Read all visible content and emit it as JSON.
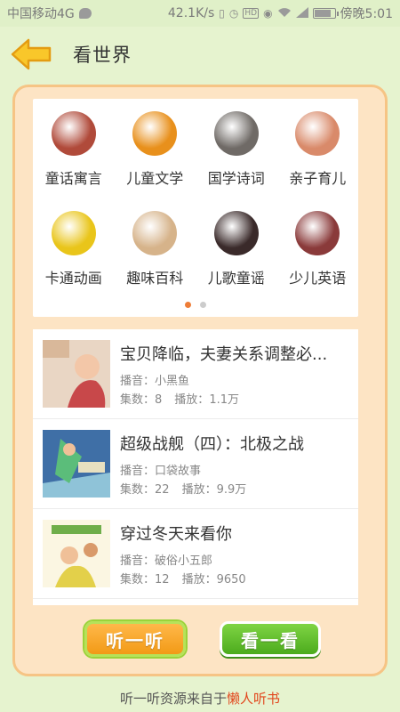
{
  "status_bar": {
    "carrier": "中国移动4G",
    "speed": "42.1K/s",
    "hd": "HD",
    "time": "傍晚5:01",
    "battery_level": 0.85
  },
  "header": {
    "back_icon": "back-arrow-icon",
    "title": "看世界"
  },
  "categories": [
    {
      "label": "童话寓言",
      "color": "#b04a3a"
    },
    {
      "label": "儿童文学",
      "color": "#e8901c"
    },
    {
      "label": "国学诗词",
      "color": "#6f6a66"
    },
    {
      "label": "亲子育儿",
      "color": "#d98a6a"
    },
    {
      "label": "卡通动画",
      "color": "#e9c51a"
    },
    {
      "label": "趣味百科",
      "color": "#d6b38a"
    },
    {
      "label": "儿歌童谣",
      "color": "#3a2a2a"
    },
    {
      "label": "少儿英语",
      "color": "#8a3a3a"
    }
  ],
  "pager": {
    "pages": 2,
    "active": 0
  },
  "list": [
    {
      "title": "宝贝降临，夫妻关系调整必...",
      "host_label": "播音：",
      "host": "小黑鱼",
      "episodes_label": "集数：",
      "episodes": "8",
      "plays_label": "播放：",
      "plays": "1.1万"
    },
    {
      "title": "超级战舰（四）：北极之战",
      "host_label": "播音：",
      "host": "口袋故事",
      "episodes_label": "集数：",
      "episodes": "22",
      "plays_label": "播放：",
      "plays": "9.9万"
    },
    {
      "title": "穿过冬天来看你",
      "host_label": "播音：",
      "host": "破俗小五郎",
      "episodes_label": "集数：",
      "episodes": "12",
      "plays_label": "播放：",
      "plays": "9650"
    }
  ],
  "buttons": {
    "listen": "听一听",
    "watch": "看一看"
  },
  "footer": {
    "text": "听一听资源来自于",
    "link": "懒人听书"
  },
  "colors": {
    "background": "#e6f3cf",
    "panel": "#fde4c4",
    "panel_border": "#f6c485",
    "accent_orange": "#f29a16",
    "accent_green": "#4cab1d",
    "link_red": "#e2471d"
  }
}
